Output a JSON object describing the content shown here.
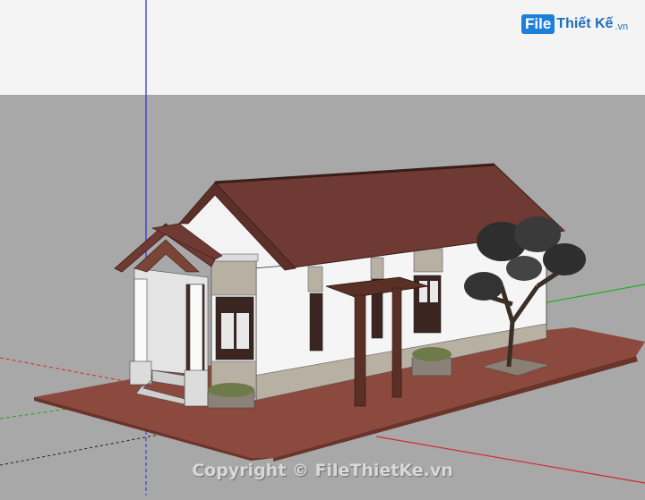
{
  "watermark": {
    "logo_file": "File",
    "logo_name": "Thiết Kế",
    "logo_tld": ".vn",
    "copyright": "Copyright © FileThietKe.vn"
  },
  "scene": {
    "sky_color": "#f4f4f4",
    "ground_color": "#a8a8a8",
    "platform_color": "#8c4a3e",
    "roof_color": "#6e3a33",
    "wall_color": "#f5f5f5",
    "stone_color": "#b9b0a4",
    "wood_color": "#5a3026",
    "tree_icon": "tree-icon"
  }
}
